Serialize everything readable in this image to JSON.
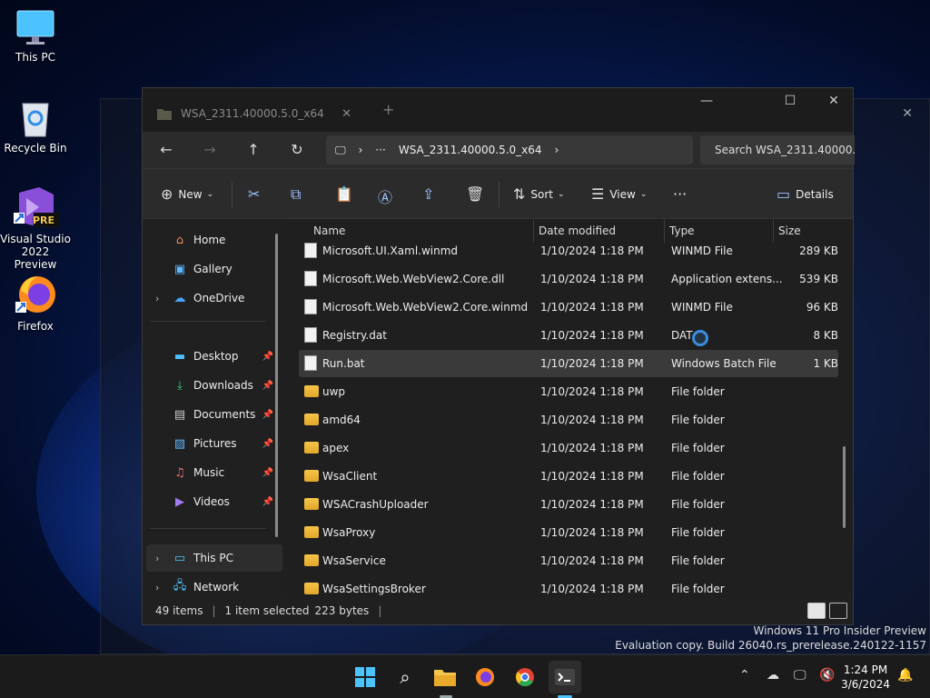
{
  "desktop": {
    "icons": [
      {
        "label": "This PC",
        "icon": "monitor-icon"
      },
      {
        "label": "Recycle Bin",
        "icon": "recycle-bin-icon"
      },
      {
        "label": "Visual Studio 2022 Preview",
        "badge": "PRE",
        "icon": "visual-studio-icon"
      },
      {
        "label": "Firefox",
        "icon": "firefox-icon"
      }
    ]
  },
  "explorer": {
    "tab": {
      "title": "WSA_2311.40000.5.0_x64",
      "close": "✕",
      "new_tab": "+"
    },
    "window_controls": {
      "minimize": "—",
      "maximize": "☐",
      "close": "✕"
    },
    "address": {
      "more": "···",
      "path": "WSA_2311.40000.5.0_x64",
      "search_placeholder": "Search WSA_2311.40000."
    },
    "toolbar": {
      "new": "New",
      "sort": "Sort",
      "view": "View",
      "more": "···",
      "details": "Details"
    },
    "sidebar": {
      "home": "Home",
      "gallery": "Gallery",
      "onedrive": "OneDrive",
      "desktop": "Desktop",
      "downloads": "Downloads",
      "documents": "Documents",
      "pictures": "Pictures",
      "music": "Music",
      "videos": "Videos",
      "this_pc": "This PC",
      "network": "Network"
    },
    "columns": {
      "name": "Name",
      "date": "Date modified",
      "type": "Type",
      "size": "Size"
    },
    "files": [
      {
        "name": "Microsoft.UI.Xaml.winmd",
        "date": "1/10/2024 1:18 PM",
        "type": "WINMD File",
        "size": "289 KB",
        "kind": "doc"
      },
      {
        "name": "Microsoft.Web.WebView2.Core.dll",
        "date": "1/10/2024 1:18 PM",
        "type": "Application extens...",
        "size": "539 KB",
        "kind": "doc"
      },
      {
        "name": "Microsoft.Web.WebView2.Core.winmd",
        "date": "1/10/2024 1:18 PM",
        "type": "WINMD File",
        "size": "96 KB",
        "kind": "doc"
      },
      {
        "name": "Registry.dat",
        "date": "1/10/2024 1:18 PM",
        "type": "DAT",
        "size": "8 KB",
        "kind": "doc"
      },
      {
        "name": "Run.bat",
        "date": "1/10/2024 1:18 PM",
        "type": "Windows Batch File",
        "size": "1 KB",
        "kind": "doc",
        "selected": true
      },
      {
        "name": "uwp",
        "date": "1/10/2024 1:18 PM",
        "type": "File folder",
        "size": "",
        "kind": "folder"
      },
      {
        "name": "amd64",
        "date": "1/10/2024 1:18 PM",
        "type": "File folder",
        "size": "",
        "kind": "folder"
      },
      {
        "name": "apex",
        "date": "1/10/2024 1:18 PM",
        "type": "File folder",
        "size": "",
        "kind": "folder"
      },
      {
        "name": "WsaClient",
        "date": "1/10/2024 1:18 PM",
        "type": "File folder",
        "size": "",
        "kind": "folder"
      },
      {
        "name": "WSACrashUploader",
        "date": "1/10/2024 1:18 PM",
        "type": "File folder",
        "size": "",
        "kind": "folder"
      },
      {
        "name": "WsaProxy",
        "date": "1/10/2024 1:18 PM",
        "type": "File folder",
        "size": "",
        "kind": "folder"
      },
      {
        "name": "WsaService",
        "date": "1/10/2024 1:18 PM",
        "type": "File folder",
        "size": "",
        "kind": "folder"
      },
      {
        "name": "WsaSettingsBroker",
        "date": "1/10/2024 1:18 PM",
        "type": "File folder",
        "size": "",
        "kind": "folder"
      }
    ],
    "status": {
      "items": "49 items",
      "selected": "1 item selected",
      "bytes": "223 bytes"
    }
  },
  "watermark": {
    "line1": "Windows 11 Pro Insider Preview",
    "line2": "Evaluation copy. Build 26040.rs_prerelease.240122-1157"
  },
  "taskbar": {
    "apps": [
      "start-icon",
      "search-icon",
      "file-explorer-icon",
      "firefox-icon",
      "chrome-icon",
      "terminal-icon"
    ],
    "time": "1:24 PM",
    "date": "3/6/2024"
  },
  "colors": {
    "accent": "#0067c0",
    "folder": "#f5c44a",
    "background": "#202020"
  }
}
